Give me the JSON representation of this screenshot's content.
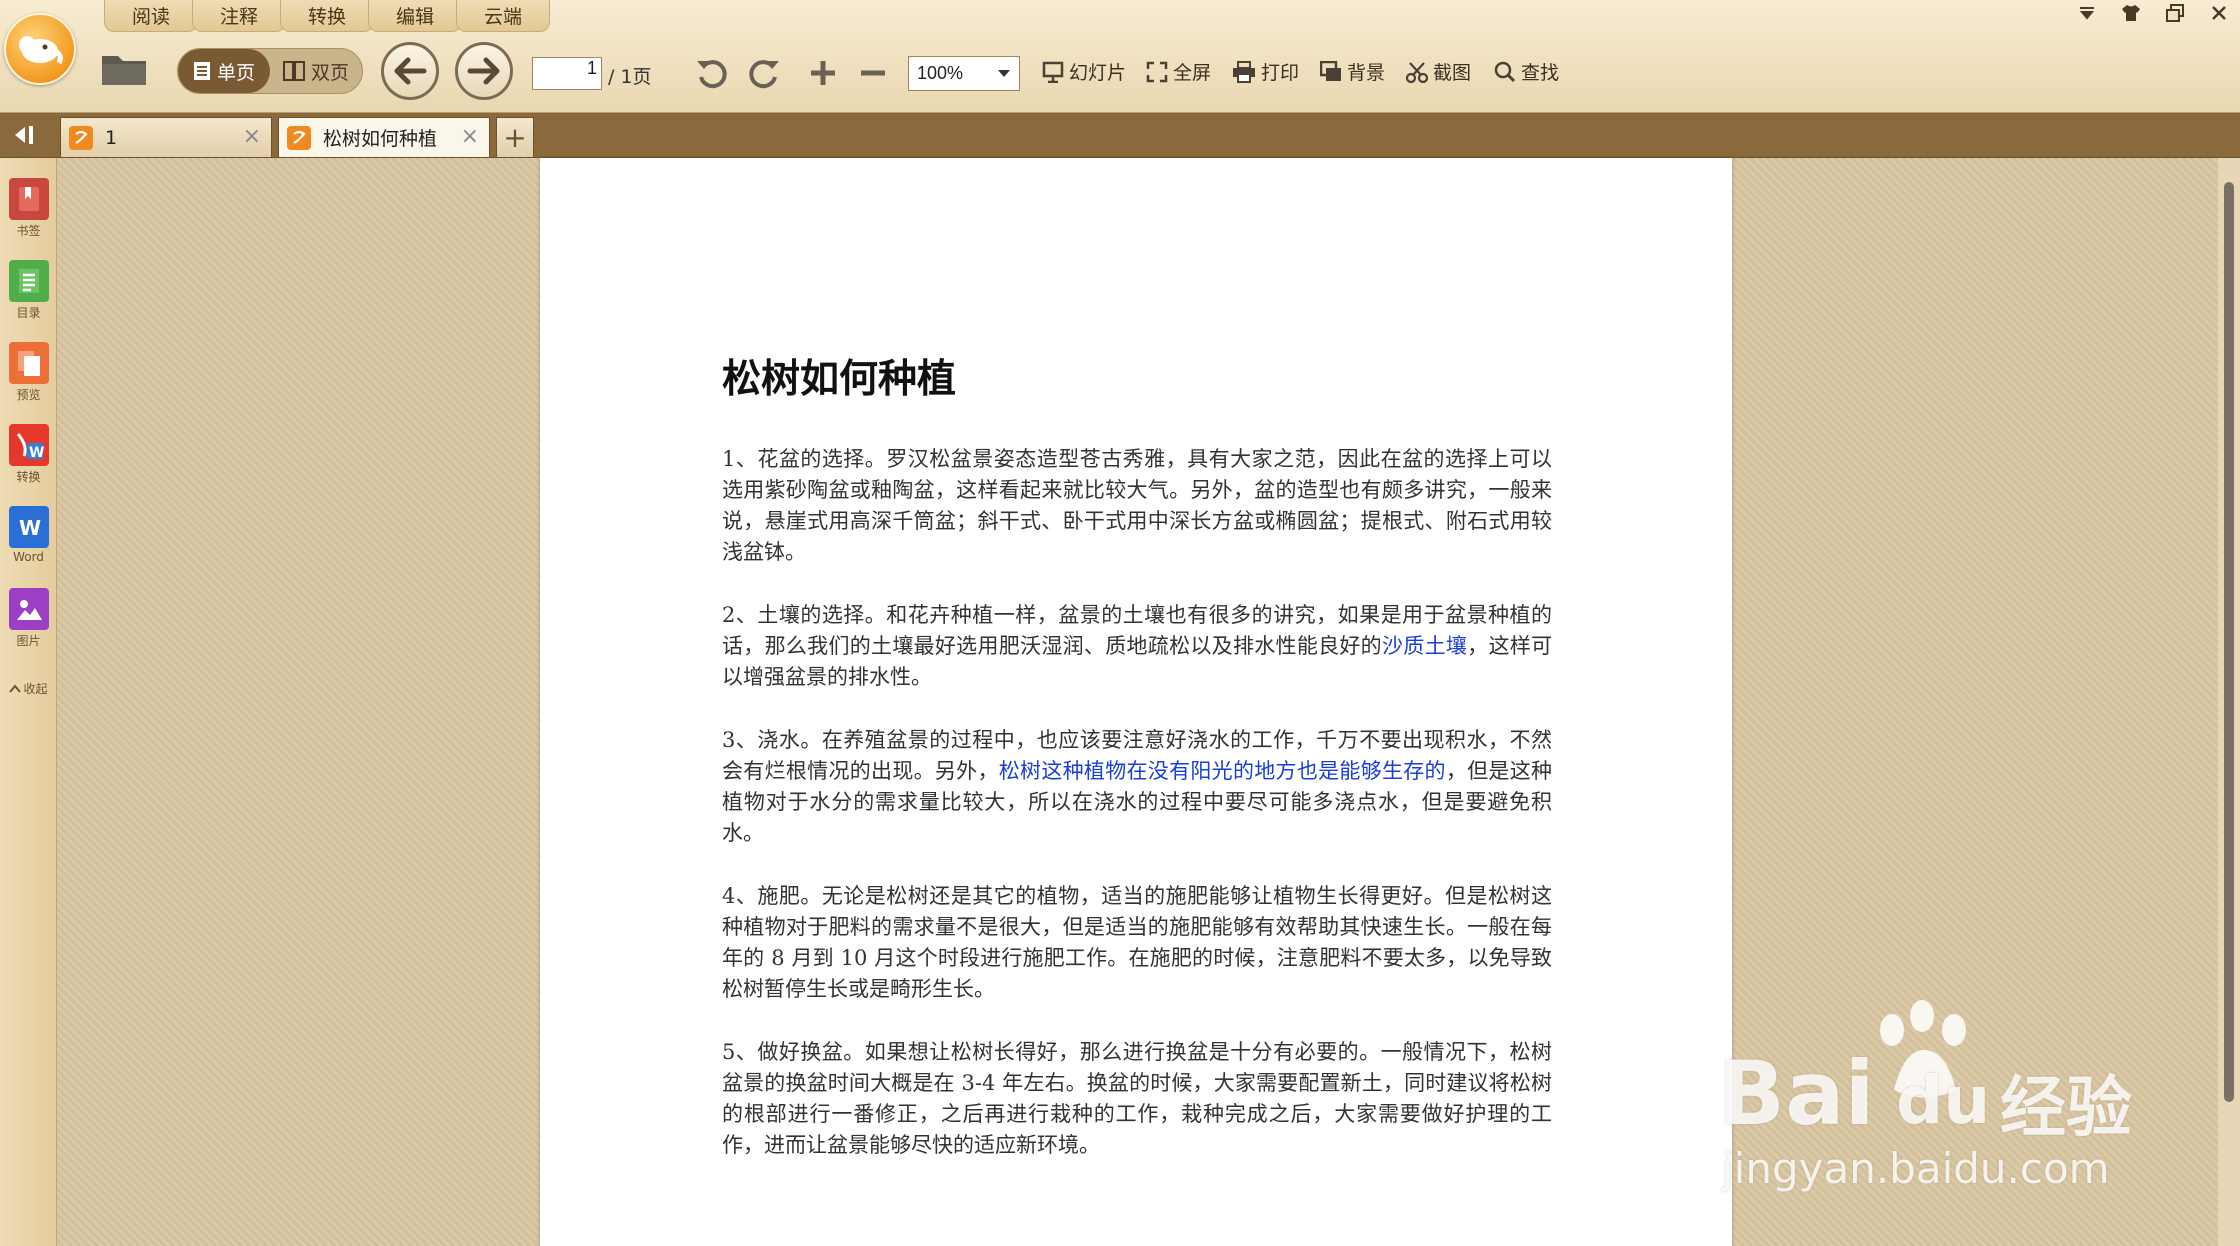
{
  "menu": {
    "tabs": [
      {
        "label": "阅读"
      },
      {
        "label": "注释"
      },
      {
        "label": "转换"
      },
      {
        "label": "编辑"
      },
      {
        "label": "云端"
      }
    ]
  },
  "toolbar": {
    "view_single": "单页",
    "view_double": "双页",
    "page_current": "1",
    "page_total": "/ 1页",
    "zoom": "100%",
    "slideshow": "幻灯片",
    "fullscreen": "全屏",
    "print": "打印",
    "background": "背景",
    "screenshot": "截图",
    "find": "查找"
  },
  "tabs": [
    {
      "title": "1",
      "active": false
    },
    {
      "title": "松树如何种植",
      "active": true
    }
  ],
  "sidebar": {
    "items": [
      {
        "label": "书签",
        "icon": "bookmark-icon",
        "color": "#d9534f"
      },
      {
        "label": "目录",
        "icon": "toc-icon",
        "color": "#5cb85c"
      },
      {
        "label": "预览",
        "icon": "preview-icon",
        "color": "#f0783c"
      },
      {
        "label": "转换",
        "icon": "convert-icon",
        "color": "#e8402f"
      },
      {
        "label": "Word",
        "icon": "word-icon",
        "color": "#2b6fd6"
      },
      {
        "label": "图片",
        "icon": "image-icon",
        "color": "#9b3fc4"
      }
    ],
    "collapse": "收起"
  },
  "document": {
    "title": "松树如何种植",
    "paragraphs": [
      {
        "text": "1、花盆的选择。罗汉松盆景姿态造型苍古秀雅，具有大家之范，因此在盆的选择上可以选用紫砂陶盆或釉陶盆，这样看起来就比较大气。另外，盆的造型也有颇多讲究，一般来说，悬崖式用高深千筒盆；斜干式、卧干式用中深长方盆或椭圆盆；提根式、附石式用较浅盆钵。"
      },
      {
        "before": "2、土壤的选择。和花卉种植一样，盆景的土壤也有很多的讲究，如果是用于盆景种植的话，那么我们的土壤最好选用肥沃湿润、质地疏松以及排水性能良好的",
        "link": "沙质土壤",
        "after": "，这样可以增强盆景的排水性。"
      },
      {
        "before": "3、浇水。在养殖盆景的过程中，也应该要注意好浇水的工作，千万不要出现积水，不然会有烂根情况的出现。另外，",
        "link": "松树这种植物在没有阳光的地方也是能够生存的",
        "after": "，但是这种植物对于水分的需求量比较大，所以在浇水的过程中要尽可能多浇点水，但是要避免积水。"
      },
      {
        "text": "4、施肥。无论是松树还是其它的植物，适当的施肥能够让植物生长得更好。但是松树这种植物对于肥料的需求量不是很大，但是适当的施肥能够有效帮助其快速生长。一般在每年的 8 月到 10 月这个时段进行施肥工作。在施肥的时候，注意肥料不要太多，以免导致松树暂停生长或是畸形生长。"
      },
      {
        "text": "5、做好换盆。如果想让松树长得好，那么进行换盆是十分有必要的。一般情况下，松树盆景的换盆时间大概是在 3-4 年左右。换盆的时候，大家需要配置新土，同时建议将松树的根部进行一番修正，之后再进行栽种的工作，栽种完成之后，大家需要做好护理的工作，进而让盆景能够尽快的适应新环境。"
      }
    ]
  },
  "watermark": {
    "brand": "Bai",
    "brand2": "du",
    "cn": "经验",
    "url": "jingyan.baidu.com"
  }
}
